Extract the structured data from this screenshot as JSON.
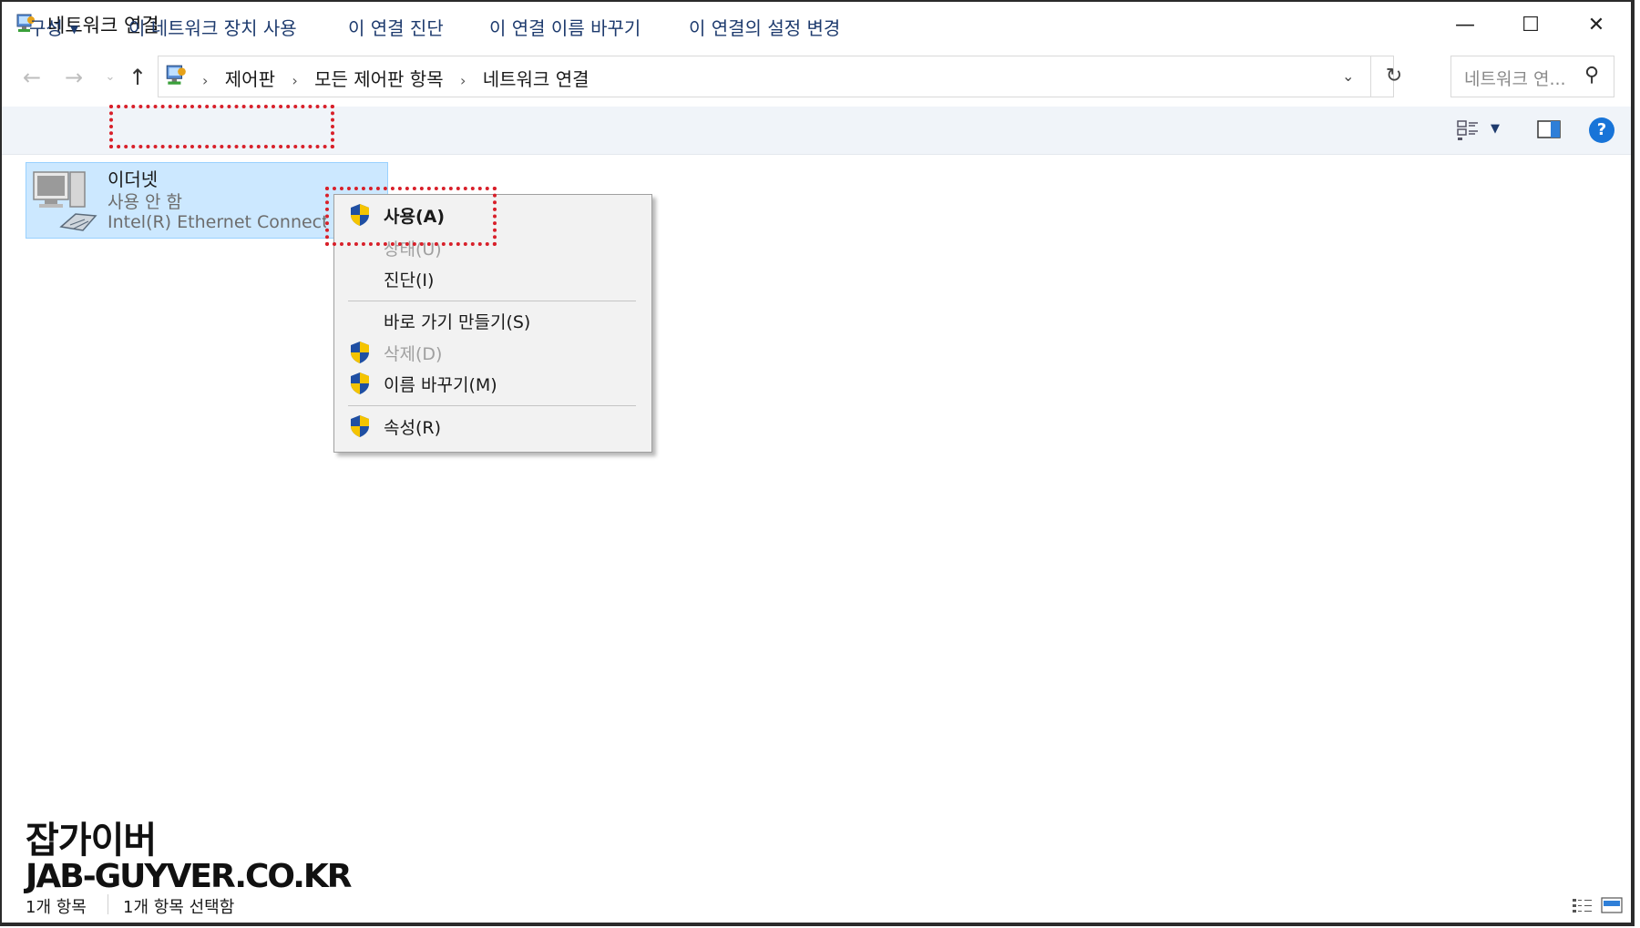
{
  "window": {
    "title": "네트워크 연결",
    "icon": "network-connections-icon",
    "controls": {
      "minimize": "—",
      "maximize": "☐",
      "close": "✕"
    }
  },
  "nav": {
    "back": "←",
    "forward": "→",
    "recent": "⌄",
    "up": "↑"
  },
  "address": {
    "breadcrumbs": [
      "제어판",
      "모든 제어판 항목",
      "네트워크 연결"
    ],
    "separator": "›",
    "dropdown": "⌄",
    "refresh": "↻"
  },
  "search": {
    "placeholder": "네트워크 연...",
    "icon": "⚲"
  },
  "commands": {
    "organize": "구성",
    "enable_device": "이 네트워크 장치 사용",
    "diagnose": "이 연결 진단",
    "rename": "이 연결 이름 바꾸기",
    "change_settings": "이 연결의 설정 변경",
    "help": "?"
  },
  "item": {
    "name": "이더넷",
    "status": "사용 안 함",
    "device": "Intel(R) Ethernet Connection"
  },
  "context_menu": {
    "enable": "사용(A)",
    "status": "상태(U)",
    "diagnose": "진단(I)",
    "create_shortcut": "바로 가기 만들기(S)",
    "delete": "삭제(D)",
    "rename": "이름 바꾸기(M)",
    "properties": "속성(R)"
  },
  "watermark": {
    "korean": "잡가이버",
    "english": "JAB-GUYVER.CO.KR"
  },
  "statusbar": {
    "count": "1개 항목",
    "selected": "1개 항목 선택함"
  },
  "colors": {
    "accent": "#1874d8",
    "selection": "#cce8ff",
    "highlight": "#d8202a",
    "command_text": "#1e3b6e"
  }
}
